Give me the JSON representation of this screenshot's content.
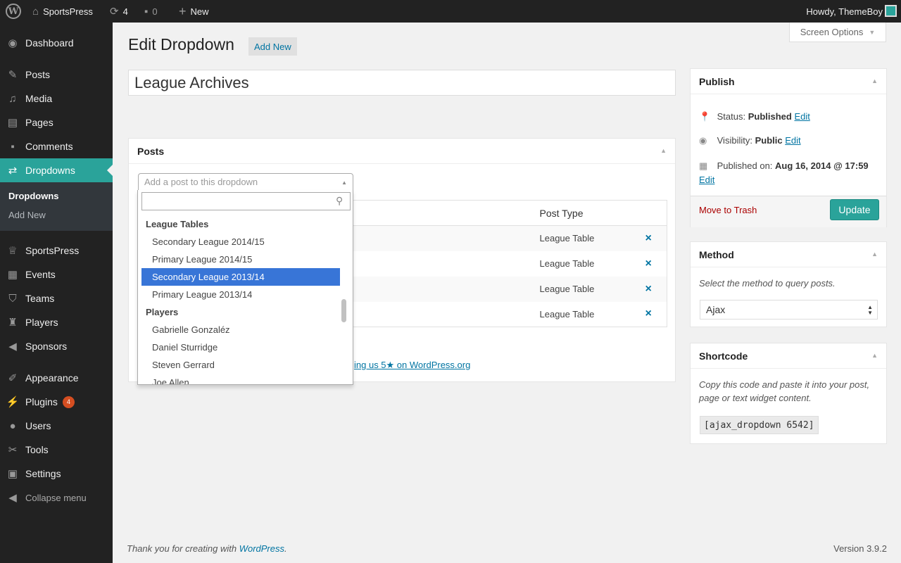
{
  "adminbar": {
    "site_name": "SportsPress",
    "updates_count": "4",
    "comments_count": "0",
    "new_label": "New",
    "howdy": "Howdy, ThemeBoy"
  },
  "sidebar": {
    "items": [
      {
        "label": "Dashboard",
        "icon": "dashboard-icon"
      },
      {
        "label": "Posts",
        "icon": "pin-icon"
      },
      {
        "label": "Media",
        "icon": "media-icon"
      },
      {
        "label": "Pages",
        "icon": "pages-icon"
      },
      {
        "label": "Comments",
        "icon": "comment-icon"
      },
      {
        "label": "Dropdowns",
        "icon": "shuffle-icon"
      },
      {
        "label": "SportsPress",
        "icon": "trophy-icon"
      },
      {
        "label": "Events",
        "icon": "calendar-icon"
      },
      {
        "label": "Teams",
        "icon": "shield-icon"
      },
      {
        "label": "Players",
        "icon": "shirt-icon"
      },
      {
        "label": "Sponsors",
        "icon": "megaphone-icon"
      },
      {
        "label": "Appearance",
        "icon": "brush-icon"
      },
      {
        "label": "Plugins",
        "icon": "plug-icon",
        "badge": "4"
      },
      {
        "label": "Users",
        "icon": "user-icon"
      },
      {
        "label": "Tools",
        "icon": "wrench-icon"
      },
      {
        "label": "Settings",
        "icon": "settings-icon"
      }
    ],
    "submenu": [
      "Dropdowns",
      "Add New"
    ],
    "collapse": "Collapse menu"
  },
  "screen_options": "Screen Options",
  "page_title": "Edit Dropdown",
  "add_new": "Add New",
  "post_title": "League Archives",
  "posts_box": {
    "title": "Posts",
    "select_placeholder": "Add a post to this dropdown",
    "table_header_type": "Post Type",
    "rows": [
      {
        "type": "League Table",
        "remove": "×"
      },
      {
        "type": "League Table",
        "remove": "×"
      },
      {
        "type": "League Table",
        "remove": "×"
      },
      {
        "type": "League Table",
        "remove": "×"
      }
    ],
    "rate_text": "ing us 5★ on WordPress.org"
  },
  "dropdown": {
    "options": [
      {
        "label": "League Tables",
        "group": true
      },
      {
        "label": "Secondary League 2014/15"
      },
      {
        "label": "Primary League 2014/15"
      },
      {
        "label": "Secondary League 2013/14",
        "highlighted": true
      },
      {
        "label": "Primary League 2013/14"
      },
      {
        "label": "Players",
        "group": true
      },
      {
        "label": "Gabrielle Gonzaléz"
      },
      {
        "label": "Daniel Sturridge"
      },
      {
        "label": "Steven Gerrard"
      },
      {
        "label": "Joe Allen"
      }
    ]
  },
  "publish": {
    "title": "Publish",
    "status_label": "Status:",
    "status_value": "Published",
    "visibility_label": "Visibility:",
    "visibility_value": "Public",
    "published_on_label": "Published on:",
    "published_on_value": "Aug 16, 2014 @ 17:59",
    "edit": "Edit",
    "trash": "Move to Trash",
    "update": "Update"
  },
  "method": {
    "title": "Method",
    "description": "Select the method to query posts.",
    "value": "Ajax"
  },
  "shortcode": {
    "title": "Shortcode",
    "description_line1": "Copy this code and paste it into your post,",
    "description_line2": "page or text widget content.",
    "code": "[ajax_dropdown 6542]"
  },
  "footer": {
    "thanks_prefix": "Thank you for creating with ",
    "thanks_link": "WordPress",
    "thanks_suffix": ".",
    "version": "Version 3.9.2"
  },
  "colors": {
    "accent": "#2aa39a",
    "link": "#0074a2",
    "highlight": "#3875d7",
    "trash": "#aa0000"
  }
}
